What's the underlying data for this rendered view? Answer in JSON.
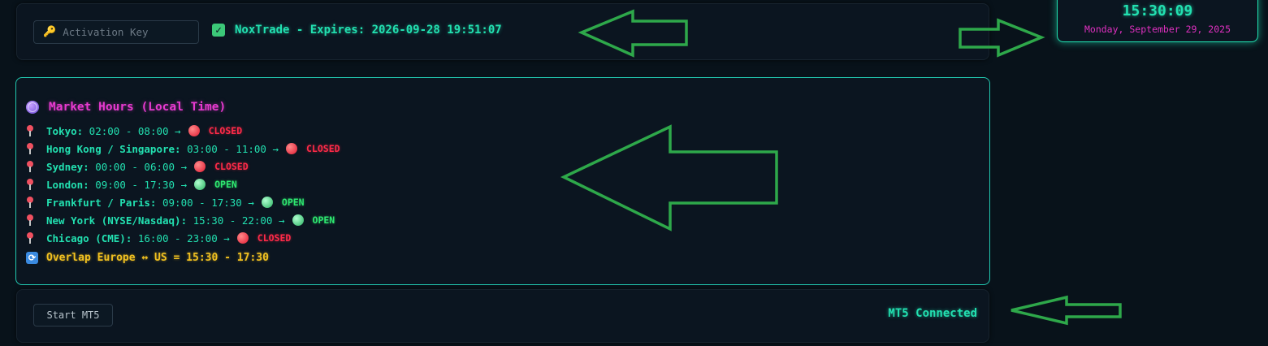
{
  "license": {
    "key_placeholder": "Activation Key",
    "status_text": "NoxTrade - Expires: 2026-09-28 19:51:07"
  },
  "clock": {
    "time": "15:30:09",
    "date": "Monday, September 29, 2025"
  },
  "market": {
    "title": "Market Hours (Local Time)",
    "rows": [
      {
        "name": "Tokyo:",
        "hours": " 02:00 - 08:00 →",
        "status": "CLOSED",
        "state": "closed"
      },
      {
        "name": "Hong Kong / Singapore:",
        "hours": " 03:00 - 11:00 →",
        "status": "CLOSED",
        "state": "closed"
      },
      {
        "name": "Sydney:",
        "hours": " 00:00 - 06:00 →",
        "status": "CLOSED",
        "state": "closed"
      },
      {
        "name": "London:",
        "hours": " 09:00 - 17:30 →",
        "status": "OPEN",
        "state": "open"
      },
      {
        "name": "Frankfurt / Paris:",
        "hours": " 09:00 - 17:30 →",
        "status": "OPEN",
        "state": "open"
      },
      {
        "name": "New York (NYSE/Nasdaq):",
        "hours": " 15:30 - 22:00 →",
        "status": "OPEN",
        "state": "open"
      },
      {
        "name": "Chicago (CME):",
        "hours": " 16:00 - 23:00 →",
        "status": "CLOSED",
        "state": "closed"
      }
    ],
    "overlap": "Overlap Europe ↔ US = 15:30 - 17:30"
  },
  "footer": {
    "start_label": "Start MT5",
    "connection_status": "MT5 Connected"
  },
  "colors": {
    "accent": "#22e0b0",
    "title": "#e83ad0",
    "closed": "#ff2a48",
    "open": "#2ee870",
    "overlap": "#f0c020",
    "annotation_arrows": "#2ea84a"
  }
}
